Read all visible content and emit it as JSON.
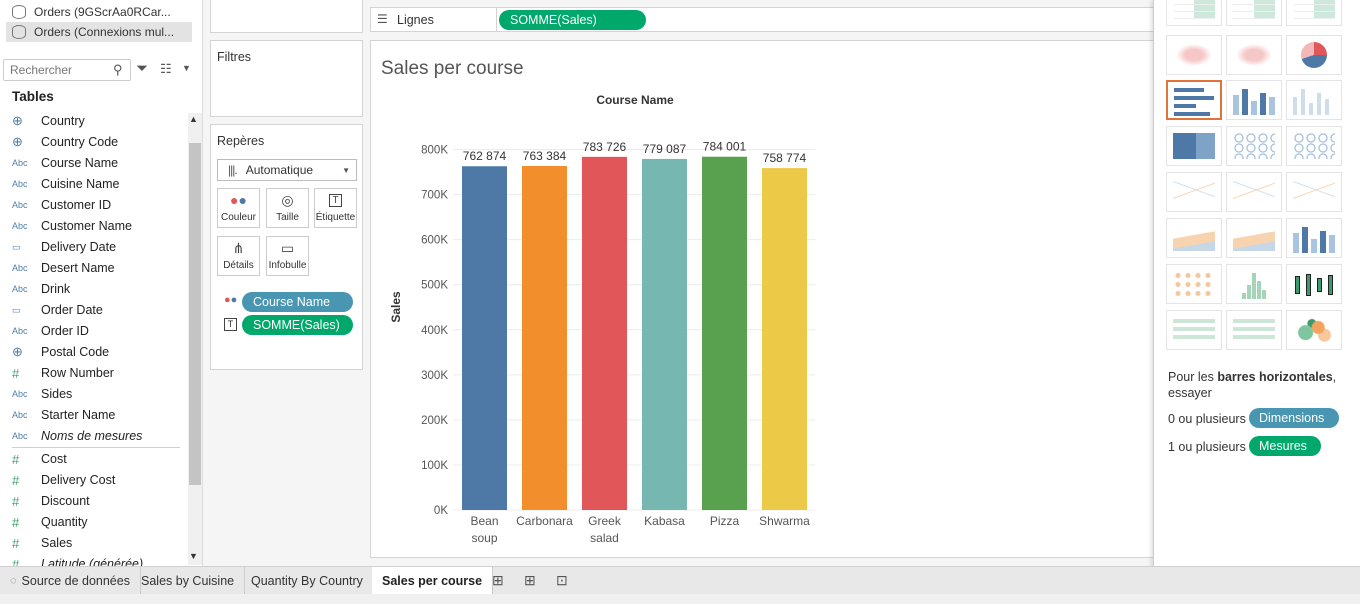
{
  "datasources": [
    "Orders (9GScrAa0RCar...",
    "Orders (Connexions mul..."
  ],
  "search_placeholder": "Rechercher",
  "tables_title": "Tables",
  "dimensions": [
    {
      "label": "Country",
      "type": "globe"
    },
    {
      "label": "Country Code",
      "type": "globe"
    },
    {
      "label": "Course Name",
      "type": "abc"
    },
    {
      "label": "Cuisine Name",
      "type": "abc"
    },
    {
      "label": "Customer ID",
      "type": "abc"
    },
    {
      "label": "Customer Name",
      "type": "abc"
    },
    {
      "label": "Delivery Date",
      "type": "date"
    },
    {
      "label": "Desert Name",
      "type": "abc"
    },
    {
      "label": "Drink",
      "type": "abc"
    },
    {
      "label": "Order Date",
      "type": "date"
    },
    {
      "label": "Order ID",
      "type": "abc"
    },
    {
      "label": "Postal Code",
      "type": "globe"
    },
    {
      "label": "Row Number",
      "type": "hash"
    },
    {
      "label": "Sides",
      "type": "abc"
    },
    {
      "label": "Starter Name",
      "type": "abc"
    },
    {
      "label": "Noms de mesures",
      "type": "abc"
    }
  ],
  "measures": [
    {
      "label": "Cost"
    },
    {
      "label": "Delivery Cost"
    },
    {
      "label": "Discount"
    },
    {
      "label": "Quantity"
    },
    {
      "label": "Sales"
    },
    {
      "label": "Latitude (générée)"
    }
  ],
  "icons_text": {
    "abc": "Abc",
    "hash": "#",
    "globe": "⊕",
    "date": "▭"
  },
  "filters_title": "Filtres",
  "marks": {
    "title": "Repères",
    "type": "Automatique",
    "buttons": [
      "Couleur",
      "Taille",
      "Étiquette",
      "Détails",
      "Infobulle"
    ],
    "pills": [
      "Course Name",
      "SOMME(Sales)"
    ]
  },
  "rows_label": "Lignes",
  "rows_pill": "SOMME(Sales)",
  "chart_data": {
    "type": "bar",
    "title": "Sales per course",
    "xlabel": "Course Name",
    "ylabel": "Sales",
    "categories": [
      "Bean soup",
      "Carbonara",
      "Greek salad",
      "Kabasa",
      "Pizza",
      "Shwarma"
    ],
    "category_lines": [
      [
        "Bean",
        "soup"
      ],
      [
        "Carbonara"
      ],
      [
        "Greek",
        "salad"
      ],
      [
        "Kabasa"
      ],
      [
        "Pizza"
      ],
      [
        "Shwarma"
      ]
    ],
    "values": [
      762874,
      763384,
      783726,
      779087,
      784001,
      758774
    ],
    "value_labels": [
      "762 874",
      "763 384",
      "783 726",
      "779 087",
      "784 001",
      "758 774"
    ],
    "colors": [
      "#4e79a7",
      "#f28e2b",
      "#e15759",
      "#76b7b2",
      "#59a14f",
      "#edc948"
    ],
    "yticks": [
      0,
      100000,
      200000,
      300000,
      400000,
      500000,
      600000,
      700000,
      800000
    ],
    "ytick_labels": [
      "0K",
      "100K",
      "200K",
      "300K",
      "400K",
      "500K",
      "600K",
      "700K",
      "800K"
    ],
    "ylim": [
      0,
      830000
    ],
    "grid": true
  },
  "showme": {
    "hint_prefix": "Pour les ",
    "hint_bold": "barres horizontales",
    "hint_suffix": ", essayer",
    "dims_prefix": "0 ou plusieurs",
    "dims_pill": "Dimensions",
    "meas_prefix": "1 ou plusieurs",
    "meas_pill": "Mesures",
    "accent": "#e0733a"
  },
  "tabs": [
    "Source de données",
    "Sales by Cuisine",
    "Quantity By Country",
    "Sales per course"
  ],
  "active_tab": "Sales per course"
}
